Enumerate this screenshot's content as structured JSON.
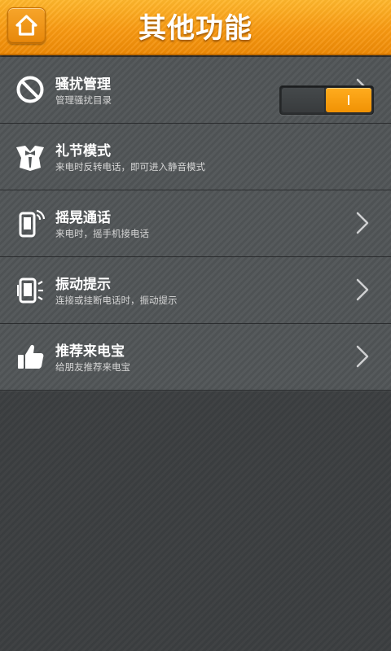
{
  "header": {
    "title": "其他功能",
    "home_icon": "home-icon",
    "accent_color": "#f99a12"
  },
  "items": [
    {
      "title": "骚扰管理",
      "subtitle": "管理骚扰目录",
      "icon": "block-icon",
      "control": "chevron"
    },
    {
      "title": "礼节模式",
      "subtitle": "来电时反转电话，即可进入静音模式",
      "icon": "tuxedo-icon",
      "control": "toggle",
      "toggle_on": true
    },
    {
      "title": "摇晃通话",
      "subtitle": "来电时，摇手机接电话",
      "icon": "shake-phone-icon",
      "control": "chevron"
    },
    {
      "title": "振动提示",
      "subtitle": "连接或挂断电话时，振动提示",
      "icon": "vibrate-phone-icon",
      "control": "chevron"
    },
    {
      "title": "推荐来电宝",
      "subtitle": "给朋友推荐来电宝",
      "icon": "thumbs-up-icon",
      "control": "chevron"
    }
  ]
}
